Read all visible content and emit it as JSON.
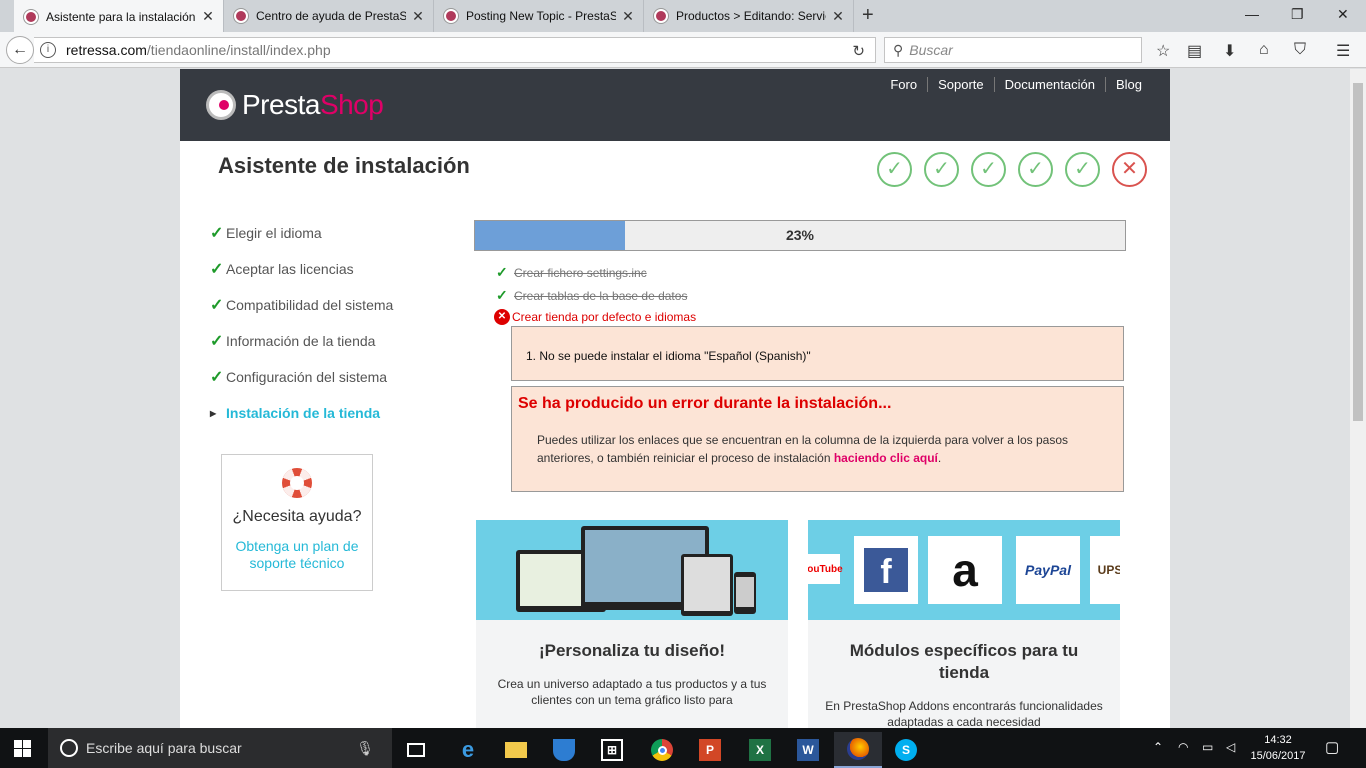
{
  "browser": {
    "tabs": [
      {
        "label": "Asistente para la instalación",
        "active": true
      },
      {
        "label": "Centro de ayuda de PrestaShop",
        "active": false
      },
      {
        "label": "Posting New Topic - PrestaShop",
        "active": false
      },
      {
        "label": "Productos > Editando: Servicio",
        "active": false
      }
    ],
    "new_tab": "+",
    "url_domain": "retressa.com",
    "url_path": "/tiendaonline/install/index.php",
    "search_placeholder": "Buscar"
  },
  "header": {
    "logo_presta": "Presta",
    "logo_shop": "Shop",
    "nav": [
      "Foro",
      "Soporte",
      "Documentación",
      "Blog"
    ]
  },
  "wizard": {
    "title": "Asistente de instalación",
    "step_marks": [
      "✓",
      "✓",
      "✓",
      "✓",
      "✓",
      "✕"
    ],
    "steps": [
      {
        "label": "Elegir el idioma",
        "state": "done"
      },
      {
        "label": "Aceptar las licencias",
        "state": "done"
      },
      {
        "label": "Compatibilidad del sistema",
        "state": "done"
      },
      {
        "label": "Información de la tienda",
        "state": "done"
      },
      {
        "label": "Configuración del sistema",
        "state": "done"
      },
      {
        "label": "Instalación de la tienda",
        "state": "current"
      }
    ],
    "progress_value": 23,
    "progress_label": "23%",
    "tasks": [
      {
        "label": "Crear fichero settings.inc",
        "state": "done"
      },
      {
        "label": "Crear tablas de la base de datos",
        "state": "done"
      },
      {
        "label": "Crear tienda por defecto e idiomas",
        "state": "failed"
      }
    ],
    "error_item": "1.  No se puede instalar el idioma \"Español (Spanish)\"",
    "error_title": "Se ha producido un error durante la instalación...",
    "error_body": "Puedes utilizar los enlaces que se encuentran en la columna de la izquierda para volver a los pasos anteriores, o también reiniciar el proceso de instalación",
    "error_link": "haciendo clic aquí",
    "error_tail": "."
  },
  "help": {
    "title": "¿Necesita ayuda?",
    "link": "Obtenga un plan de soporte técnico"
  },
  "promos": [
    {
      "title": "¡Personaliza tu diseño!",
      "body": "Crea un universo adaptado a tus productos y a tus clientes con un tema gráfico listo para"
    },
    {
      "title": "Módulos específicos para tu tienda",
      "body": "En PrestaShop Addons encontrarás funcionalidades adaptadas a cada necesidad"
    }
  ],
  "brands": [
    "YouTube",
    "f",
    "a",
    "PayPal",
    "UPS"
  ],
  "taskbar": {
    "search_placeholder": "Escribe aquí para buscar",
    "time": "14:32",
    "date": "15/06/2017"
  },
  "colors": {
    "accent": "#25b9d7",
    "brand": "#df0067",
    "header_bg": "#363a41",
    "success": "#72c279",
    "error": "#d9534f"
  }
}
